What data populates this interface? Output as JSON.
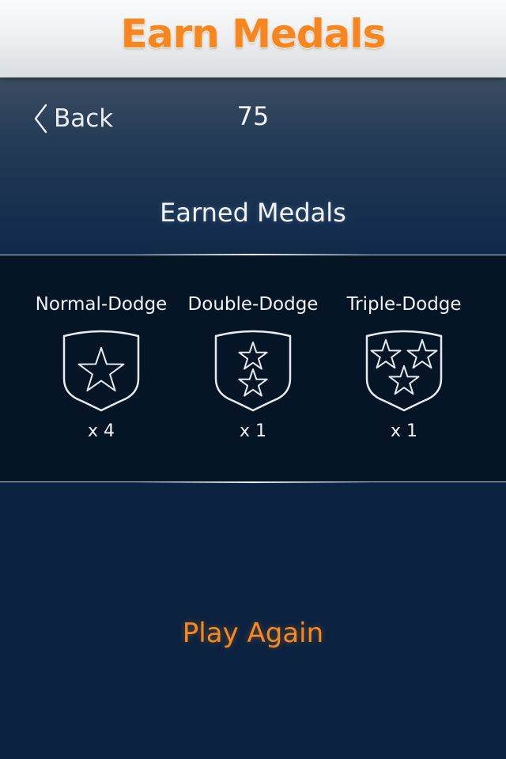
{
  "header": {
    "title": "Earn Medals"
  },
  "nav": {
    "back_label": "Back"
  },
  "score": "75",
  "section": {
    "title": "Earned Medals"
  },
  "medals": [
    {
      "name": "Normal-Dodge",
      "count": "x 4",
      "icon": "one-star-shield-icon"
    },
    {
      "name": "Double-Dodge",
      "count": "x 1",
      "icon": "two-star-shield-icon"
    },
    {
      "name": "Triple-Dodge",
      "count": "x 1",
      "icon": "three-star-shield-icon"
    }
  ],
  "actions": {
    "play_again_label": "Play Again"
  },
  "colors": {
    "accent": "#f7861f",
    "background": "#0b2340",
    "panel": "#061526",
    "text": "#f0f3f7"
  }
}
